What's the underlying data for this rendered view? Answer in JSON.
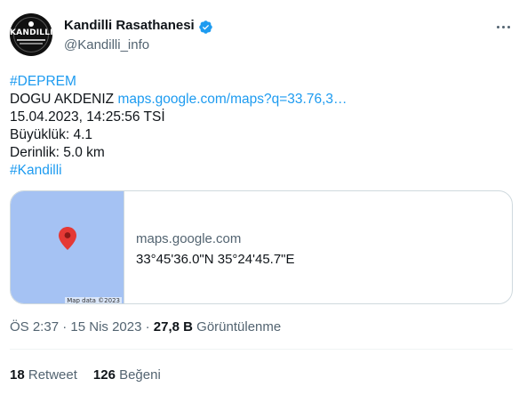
{
  "author": {
    "display_name": "Kandilli Rasathanesi",
    "handle": "@Kandilli_info",
    "avatar_text": "KANDILLI",
    "verified_icon": "verified-badge-icon",
    "verified_color": "#1d9bf0"
  },
  "tweet": {
    "hashtag1": "#DEPREM",
    "location": "DOGU AKDENIZ",
    "map_link": "maps.google.com/maps?q=33.76,3…",
    "datetime": "15.04.2023, 14:25:56 TSİ",
    "magnitude": "Büyüklük: 4.1",
    "depth": "Derinlik: 5.0 km",
    "hashtag2": "#Kandilli"
  },
  "card": {
    "domain": "maps.google.com",
    "title": "33°45'36.0\"N 35°24'45.7\"E",
    "map_attribution": "Map data ©2023",
    "pin_color": "#e53935",
    "map_color": "#a5c2f3"
  },
  "meta": {
    "time": "ÖS 2:37",
    "separator1": " · ",
    "date": "15 Nis 2023",
    "separator2": " · ",
    "views_count": "27,8 B",
    "views_label": " Görüntülenme"
  },
  "stats": {
    "retweets_count": "18",
    "retweets_label": " Retweet",
    "likes_count": "126",
    "likes_label": " Beğeni"
  },
  "colors": {
    "link": "#1d9bf0",
    "secondary_text": "#536471",
    "primary_text": "#0f1419",
    "border": "#cfd9de"
  }
}
